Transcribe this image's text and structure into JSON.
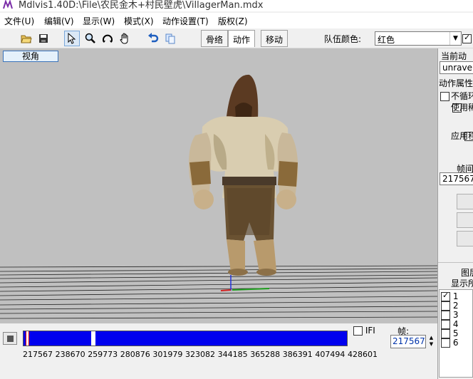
{
  "window": {
    "title": "Mdlvis1.40D:\\File\\农民金木+村民壁虎\\VillagerMan.mdx"
  },
  "menu": [
    "文件(U)",
    "编辑(V)",
    "显示(W)",
    "模式(X)",
    "动作设置(T)",
    "版权(Z)"
  ],
  "toolbar": {
    "icons": [
      "open-folder-icon",
      "save-icon",
      "select-arrow-icon",
      "zoom-icon",
      "rotate-icon",
      "pan-hand-icon",
      "undo-icon",
      "copy-icon"
    ],
    "tabs": [
      "骨络",
      "动作",
      "移动"
    ],
    "active_tab": "动作",
    "team_color_label": "队伍颜色:",
    "team_color_value": "红色"
  },
  "viewport": {
    "view_angle_button": "视角"
  },
  "right_panel": {
    "current_anim_label": "当前动",
    "anim_name": "unravel",
    "anim_props_label": "动作属性",
    "no_loop_label": "不循环",
    "use_rarity_label": "使用稀",
    "apply_move_label": "应用移",
    "interval_label": "帧间",
    "interval_value": "217567",
    "layers_label": "图层",
    "show_all_label": "显示所",
    "layers": [
      {
        "label": "1",
        "checked": true
      },
      {
        "label": "2",
        "checked": false
      },
      {
        "label": "3",
        "checked": false
      },
      {
        "label": "4",
        "checked": false
      },
      {
        "label": "5",
        "checked": false
      },
      {
        "label": "6",
        "checked": false
      }
    ]
  },
  "timeline": {
    "ticks": [
      "217567",
      "238670",
      "259773",
      "280876",
      "301979",
      "323082",
      "344185",
      "365288",
      "386391",
      "407494",
      "428601"
    ],
    "ifi_label": "IFI",
    "frame_label": "帧:",
    "frame_value": "217567",
    "track_color": "#0000ee"
  }
}
